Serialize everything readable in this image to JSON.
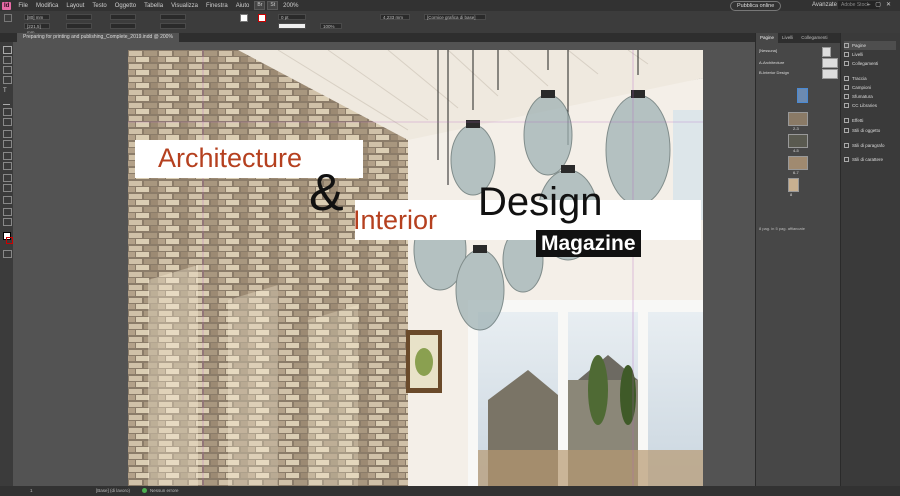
{
  "app": {
    "logo": "Id"
  },
  "menu": [
    "File",
    "Modifica",
    "Layout",
    "Testo",
    "Oggetto",
    "Tabella",
    "Visualizza",
    "Finestra",
    "Aiuto"
  ],
  "zoom": "200%",
  "publish_label": "Pubblica online",
  "workspace": "Avanzate",
  "search_placeholder": "Adobe Stock",
  "control": {
    "x": "[80] mm",
    "y": "[221,5] mm",
    "stroke": "0 pt",
    "opacity": "100%",
    "size": "4,233 mm",
    "frame": "[Cornice grafica di base]"
  },
  "document_tab": "Preparing for printing and publishing_Complete_2019.indd @ 200%",
  "cover": {
    "line1": "Architecture",
    "amp": "&",
    "line2": "Interior",
    "line3": "Design",
    "badge": "Magazine"
  },
  "pages_panel": {
    "tabs": [
      "Pagine",
      "Livelli",
      "Collegamenti"
    ],
    "none": "[Nessuna]",
    "master_a": "A-Architecture",
    "master_b": "B-Interior Design",
    "spreads": [
      "2-3",
      "4-5",
      "6-7",
      "8"
    ],
    "status": "8 pag. in 5 pag. affiancate"
  },
  "side_panels": [
    "Pagine",
    "Livelli",
    "Collegamenti",
    "Traccia",
    "Campioni",
    "Sfumatura",
    "CC Libraries",
    "Effetti",
    "Stili di oggetto",
    "Stili di paragrafo",
    "Stili di carattere"
  ],
  "status": {
    "page": "1",
    "style": "[Base] (di lavoro)",
    "errors": "Nessun errore"
  }
}
